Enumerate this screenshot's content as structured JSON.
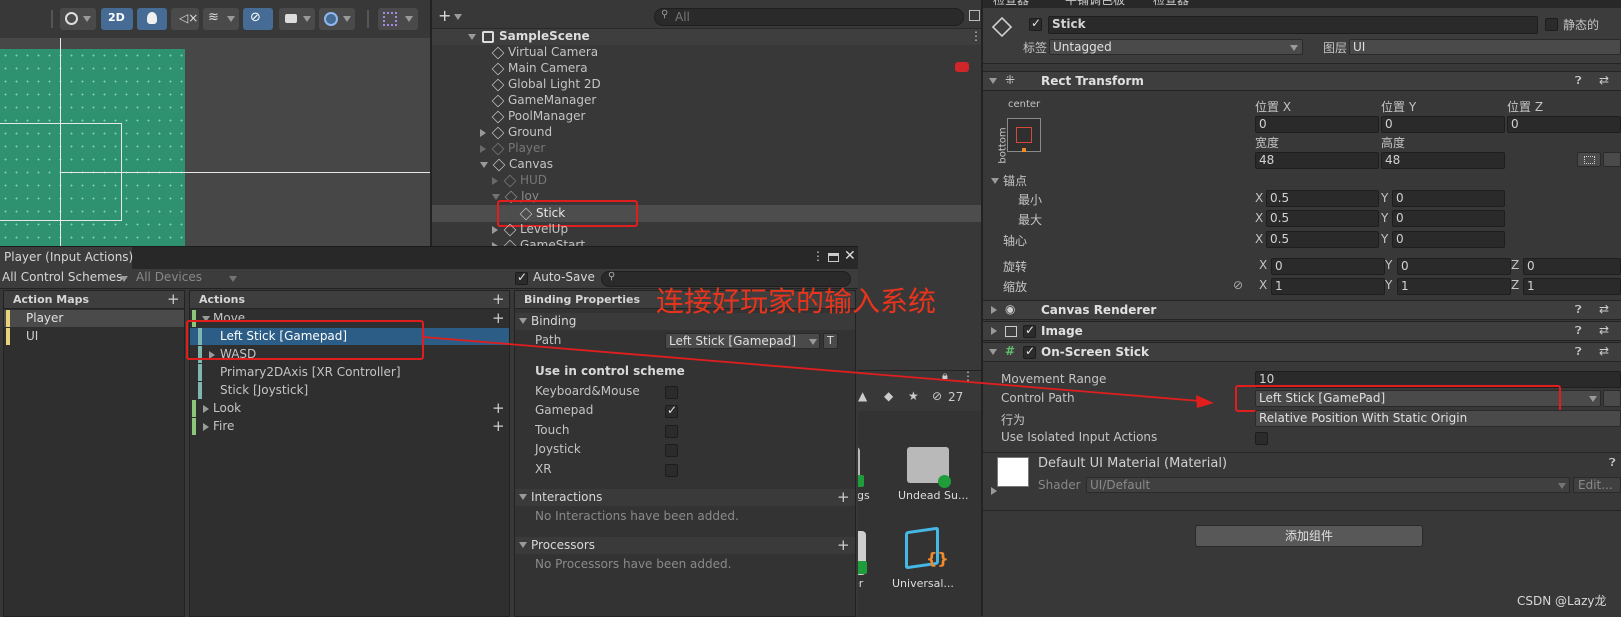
{
  "scene_toolbar": {
    "mode_2d": "2D"
  },
  "hierarchy": {
    "search_placeholder": "All",
    "scene_name": "SampleScene",
    "items": [
      "Virtual Camera",
      "Main Camera",
      "Global Light 2D",
      "GameManager",
      "PoolManager",
      "Ground",
      "Player",
      "Canvas",
      "HUD",
      "Joy",
      "Stick",
      "LevelUp",
      "GameStart"
    ]
  },
  "input_actions": {
    "title": "Player (Input Actions)",
    "control_schemes": "All Control Schemes",
    "devices": "All Devices",
    "auto_save": "Auto-Save",
    "action_maps_header": "Action Maps",
    "action_maps": [
      "Player",
      "UI"
    ],
    "actions_header": "Actions",
    "actions": {
      "move": "Move",
      "left_stick": "Left Stick [Gamepad]",
      "wasd": "WASD",
      "primary2d": "Primary2DAxis [XR Controller]",
      "stick_joystick": "Stick [Joystick]",
      "look": "Look",
      "fire": "Fire"
    },
    "binding_props_header": "Binding Properties",
    "binding_section": "Binding",
    "path_label": "Path",
    "path_value": "Left Stick [Gamepad]",
    "path_t": "T",
    "use_in_scheme": "Use in control scheme",
    "schemes": [
      {
        "name": "Keyboard&Mouse",
        "checked": false
      },
      {
        "name": "Gamepad",
        "checked": true
      },
      {
        "name": "Touch",
        "checked": false
      },
      {
        "name": "Joystick",
        "checked": false
      },
      {
        "name": "XR",
        "checked": false
      }
    ],
    "interactions": "Interactions",
    "no_interactions": "No Interactions have been added.",
    "processors": "Processors",
    "no_processors": "No Processors have been added."
  },
  "annotation": {
    "text": "连接好玩家的输入系统",
    "color": "#e8341c"
  },
  "project": {
    "count": "27",
    "items": [
      {
        "label": "ngs"
      },
      {
        "label": "Undead Su..."
      },
      {
        "label": "er"
      },
      {
        "label": "Universal..."
      }
    ]
  },
  "inspector": {
    "tabs": [
      "检查器",
      "平铺调色板",
      "检查器"
    ],
    "object_name": "Stick",
    "static_label": "静态的",
    "tag_label": "标签",
    "tag_value": "Untagged",
    "layer_label": "图层",
    "layer_value": "UI",
    "rect_transform": "Rect Transform",
    "anchor_h": "center",
    "anchor_v": "bottom",
    "pos_x_label": "位置 X",
    "pos_x": "0",
    "pos_y_label": "位置 Y",
    "pos_y": "0",
    "pos_z_label": "位置 Z",
    "pos_z": "0",
    "width_label": "宽度",
    "width": "48",
    "height_label": "高度",
    "height": "48",
    "anchors_label": "锚点",
    "min_label": "最小",
    "min_x": "0.5",
    "min_y": "0",
    "max_label": "最大",
    "max_x": "0.5",
    "max_y": "0",
    "pivot_label": "轴心",
    "pivot_x": "0.5",
    "pivot_y": "0",
    "rotation_label": "旋转",
    "rot_x": "0",
    "rot_y": "0",
    "rot_z": "0",
    "scale_label": "缩放",
    "scale_x": "1",
    "scale_y": "1",
    "scale_z": "1",
    "x": "X",
    "y": "Y",
    "z": "Z",
    "canvas_renderer": "Canvas Renderer",
    "image": "Image",
    "on_screen_stick": "On-Screen Stick",
    "movement_range_label": "Movement Range",
    "movement_range": "10",
    "control_path_label": "Control Path",
    "control_path": "Left Stick [GamePad]",
    "behaviour_label": "行为",
    "behaviour": "Relative Position With Static Origin",
    "use_isolated_label": "Use Isolated Input Actions",
    "material_name": "Default UI Material (Material)",
    "shader_label": "Shader",
    "shader_value": "UI/Default",
    "edit_label": "Edit...",
    "add_component": "添加组件"
  },
  "watermark": "CSDN @Lazy龙"
}
